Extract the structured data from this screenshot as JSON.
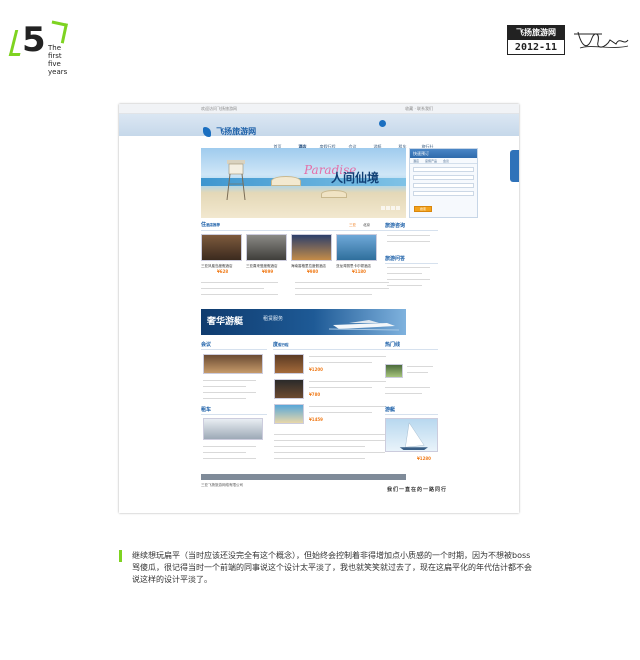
{
  "brand": {
    "digit": "5",
    "sub1": "The first",
    "sub2": "five years"
  },
  "badge": {
    "title": "飞扬旅游网",
    "date": "2012-11"
  },
  "site": {
    "logo_text": "飞扬旅游网",
    "menu": [
      "首页",
      "酒店",
      "度假行程",
      "会议",
      "游艇",
      "租车",
      "旅行社"
    ],
    "active_menu_index": 1,
    "banner_script": "Paradise",
    "banner_title": "人间仙境",
    "booking_title": "快速预订",
    "booking_tabs": [
      "酒店",
      "度假产品",
      "会议"
    ],
    "booking_button": "搜索",
    "section_hotel": "住",
    "section_hotel_sub": "酒店推荐",
    "section_hotel_en": "Boutique Hotel",
    "hotel_tabs": [
      "三亚",
      "北京"
    ],
    "hotels": [
      {
        "name": "三亚凤凰岛度假酒店",
        "price": "¥628"
      },
      {
        "name": "三亚喜来登度假酒店",
        "price": "¥899"
      },
      {
        "name": "海南香格里拉度假酒店",
        "price": "¥980"
      },
      {
        "name": "亚龙湾丽思卡尔顿酒店",
        "price": "¥1180"
      }
    ],
    "cruise_title": "奢华游艇",
    "cruise_sub": "租赁服务",
    "cruise_note": "Yacht Leasing",
    "section_meeting": "会议",
    "section_meeting_en": "Meeting",
    "section_holiday": "度",
    "section_holiday_sub": "假行程",
    "section_holiday_en": "Holiday",
    "section_car": "租车",
    "section_car_en": "Car",
    "right_service": "旅游咨询",
    "right_news": "旅游问答",
    "right_hot": "热门线",
    "right_yacht": "游艇",
    "holiday_prices": [
      "¥1200",
      "¥780",
      "¥1459"
    ],
    "right_price": "¥1280",
    "footer_text": "三亚飞扬旅游网络有限公司",
    "slogan": "我们一直在的一路同行",
    "colors": {
      "accent": "#1b6fc0",
      "price": "#f07c1b",
      "brand_green": "#7ed321"
    }
  },
  "caption": "继续想玩扁平（当时应该还没完全有这个概念），但始终会控制着非得增加点小质感的一个时期，因为不想被boss骂傻瓜，很记得当时一个前端的同事说这个设计太平淡了，我也就笑笑就过去了，现在这扁平化的年代估计都不会说这样的设计平淡了。"
}
